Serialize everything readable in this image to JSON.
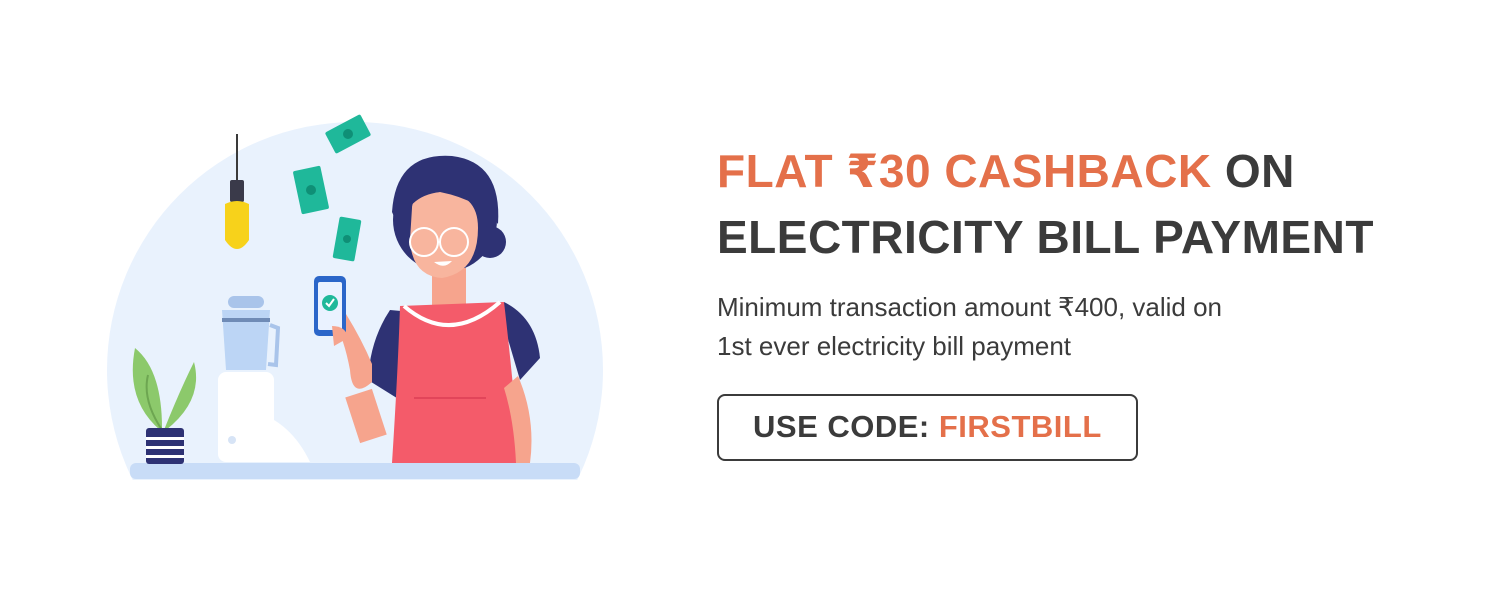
{
  "offer": {
    "headline_accent": "FLAT ₹30 CASHBACK",
    "headline_rest_line1": " ON",
    "headline_line2": "ELECTRICITY BILL PAYMENT",
    "description_line1": "Minimum transaction amount ₹400, valid on",
    "description_line2": "1st ever electricity bill payment",
    "code_label": "USE CODE: ",
    "code_value": "FIRSTBILL"
  },
  "colors": {
    "accent": "#e4704a",
    "text": "#3b3b3b",
    "circle_bg": "#e8f1fd",
    "shirt_sleeve": "#2e3274",
    "dress": "#f45b6a",
    "money": "#1fb89a",
    "bulb": "#f7d21b"
  },
  "icons": [
    "light-bulb-icon",
    "money-note-icon",
    "phone-check-icon",
    "plant-icon",
    "blender-icon"
  ]
}
